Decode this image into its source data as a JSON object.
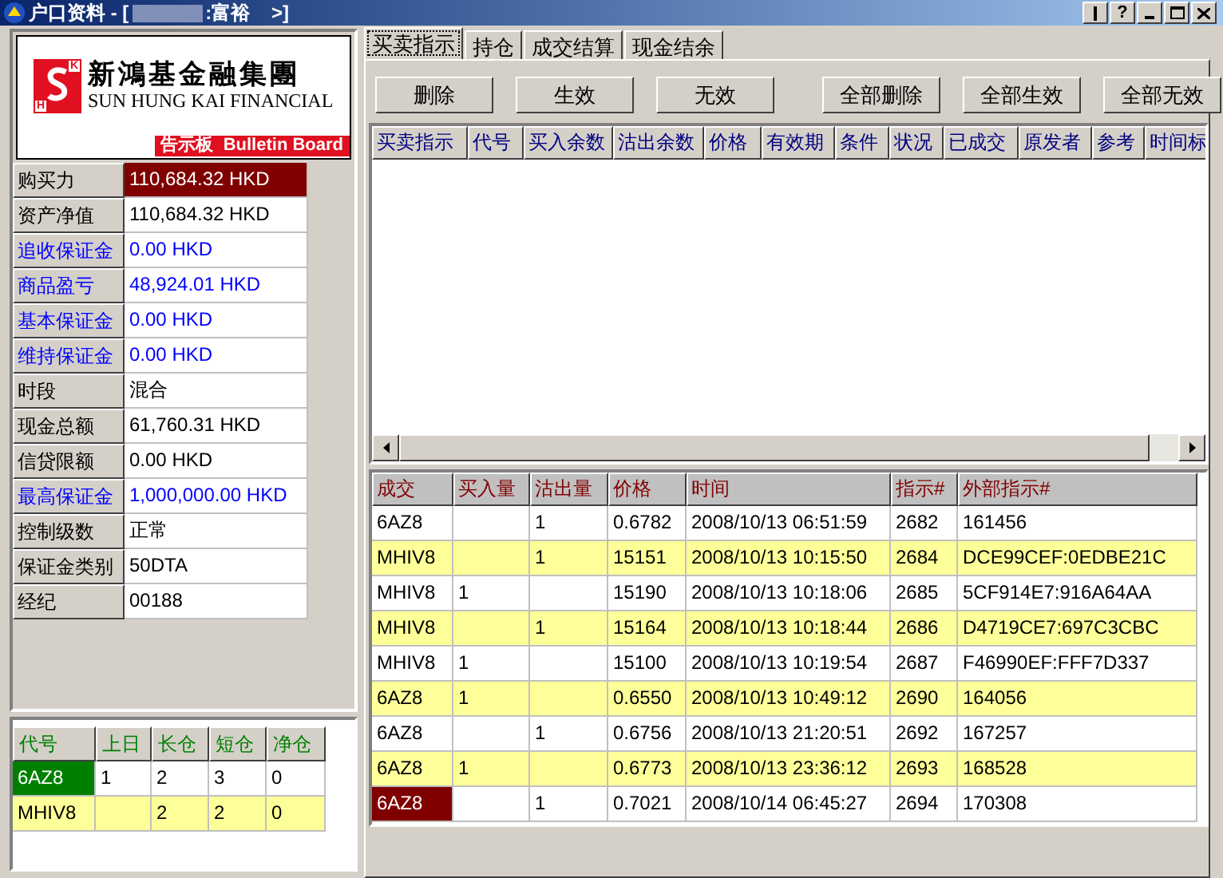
{
  "window": {
    "title_prefix": "户口资料 - [",
    "title_suffix": ":富裕    >]",
    "help": "?"
  },
  "logo": {
    "letters": [
      "K",
      "H"
    ],
    "name_cn": "新鴻基金融集團",
    "name_en": "SUN HUNG KAI FINANCIAL",
    "bulletin": "告示板  Bulletin Board"
  },
  "account": [
    {
      "label": "购买力",
      "value": "110,684.32 HKD",
      "color": "#000000",
      "selected": true
    },
    {
      "label": "资产净值",
      "value": "110,684.32 HKD",
      "color": "#000000",
      "selected": false
    },
    {
      "label": "追收保证金",
      "value": "0.00 HKD",
      "color": "#0000ff",
      "selected": false
    },
    {
      "label": "商品盈亏",
      "value": "48,924.01 HKD",
      "color": "#0000ff",
      "selected": false
    },
    {
      "label": "基本保证金",
      "value": "0.00 HKD",
      "color": "#0000ff",
      "selected": false
    },
    {
      "label": "维持保证金",
      "value": "0.00 HKD",
      "color": "#0000ff",
      "selected": false
    },
    {
      "label": "时段",
      "value": "混合",
      "color": "#000000",
      "selected": false
    },
    {
      "label": "现金总额",
      "value": "61,760.31 HKD",
      "color": "#000000",
      "selected": false
    },
    {
      "label": "信贷限额",
      "value": "0.00 HKD",
      "color": "#000000",
      "selected": false
    },
    {
      "label": "最高保证金",
      "value": "1,000,000.00 HKD",
      "color": "#0000ff",
      "selected": false
    },
    {
      "label": "控制级数",
      "value": "正常",
      "color": "#000000",
      "selected": false
    },
    {
      "label": "保证金类别",
      "value": "50DTA",
      "color": "#000000",
      "selected": false
    },
    {
      "label": "经纪",
      "value": "00188",
      "color": "#000000",
      "selected": false
    }
  ],
  "positions": {
    "columns": [
      "代号",
      "上日",
      "长仓",
      "短仓",
      "净仓"
    ],
    "rows": [
      {
        "cells": [
          "6AZ8",
          "1",
          "2",
          "3",
          "0"
        ],
        "shaded": false,
        "selected": true
      },
      {
        "cells": [
          "MHIV8",
          "",
          "2",
          "2",
          "0"
        ],
        "shaded": true,
        "selected": false
      }
    ]
  },
  "tabs": [
    {
      "label": "买卖指示",
      "selected": true
    },
    {
      "label": "持仓",
      "selected": false
    },
    {
      "label": "成交结算",
      "selected": false
    },
    {
      "label": "现金结余",
      "selected": false
    }
  ],
  "buttons": [
    "删除",
    "生效",
    "无效",
    "全部删除",
    "全部生效",
    "全部无效"
  ],
  "orders": {
    "columns": [
      "买卖指示",
      "代号",
      "买入余数",
      "沽出余数",
      "价格",
      "有效期",
      "条件",
      "状况",
      "已成交",
      "原发者",
      "参考",
      "时间标"
    ]
  },
  "trades": {
    "columns": [
      "成交",
      "买入量",
      "沽出量",
      "价格",
      "时间",
      "指示#",
      "外部指示#"
    ],
    "rows": [
      {
        "cells": [
          "6AZ8",
          "",
          "1",
          "0.6782",
          "2008/10/13 06:51:59",
          "2682",
          "161456"
        ],
        "shaded": false,
        "selected": false
      },
      {
        "cells": [
          "MHIV8",
          "",
          "1",
          "15151",
          "2008/10/13 10:15:50",
          "2684",
          "DCE99CEF:0EDBE21C"
        ],
        "shaded": true,
        "selected": false
      },
      {
        "cells": [
          "MHIV8",
          "1",
          "",
          "15190",
          "2008/10/13 10:18:06",
          "2685",
          "5CF914E7:916A64AA"
        ],
        "shaded": false,
        "selected": false
      },
      {
        "cells": [
          "MHIV8",
          "",
          "1",
          "15164",
          "2008/10/13 10:18:44",
          "2686",
          "D4719CE7:697C3CBC"
        ],
        "shaded": true,
        "selected": false
      },
      {
        "cells": [
          "MHIV8",
          "1",
          "",
          "15100",
          "2008/10/13 10:19:54",
          "2687",
          "F46990EF:FFF7D337"
        ],
        "shaded": false,
        "selected": false
      },
      {
        "cells": [
          "6AZ8",
          "1",
          "",
          "0.6550",
          "2008/10/13 10:49:12",
          "2690",
          "164056"
        ],
        "shaded": true,
        "selected": false
      },
      {
        "cells": [
          "6AZ8",
          "",
          "1",
          "0.6756",
          "2008/10/13 21:20:51",
          "2692",
          "167257"
        ],
        "shaded": false,
        "selected": false
      },
      {
        "cells": [
          "6AZ8",
          "1",
          "",
          "0.6773",
          "2008/10/13 23:36:12",
          "2693",
          "168528"
        ],
        "shaded": true,
        "selected": false
      },
      {
        "cells": [
          "6AZ8",
          "",
          "1",
          "0.7021",
          "2008/10/14 06:45:27",
          "2694",
          "170308"
        ],
        "shaded": false,
        "selected": true
      }
    ]
  }
}
